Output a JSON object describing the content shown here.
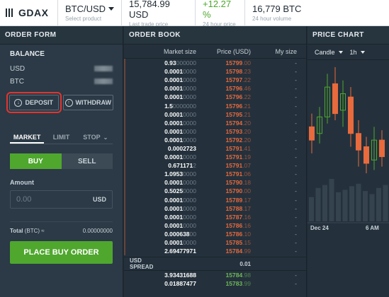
{
  "header": {
    "logo": "GDAX",
    "product": {
      "value": "BTC/USD",
      "caption": "Select product"
    },
    "last_trade": {
      "value": "15,784.99 USD",
      "caption": "Last trade price"
    },
    "change": {
      "value": "+12.27 %",
      "caption": "24 hour price"
    },
    "volume": {
      "value": "16,779 BTC",
      "caption": "24 hour volume"
    },
    "colors": {
      "green": "#4fa72e",
      "red": "#e86a3d",
      "annotation": "#e3342f"
    }
  },
  "order_form": {
    "title": "ORDER FORM",
    "balance_title": "BALANCE",
    "balances": [
      {
        "currency": "USD"
      },
      {
        "currency": "BTC"
      }
    ],
    "deposit_label": "DEPOSIT",
    "withdraw_label": "WITHDRAW",
    "tabs": [
      "MARKET",
      "LIMIT",
      "STOP"
    ],
    "buy_label": "BUY",
    "sell_label": "SELL",
    "amount_label": "Amount",
    "amount_placeholder": "0.00",
    "amount_unit": "USD",
    "total_label": "Total",
    "total_unit": "(BTC) ≈",
    "total_value": "0.00000000",
    "place_order_label": "PLACE BUY ORDER"
  },
  "order_book": {
    "title": "ORDER BOOK",
    "columns": [
      "Market size",
      "Price (USD)",
      "My size"
    ],
    "asks": [
      {
        "size_bold": "0.93",
        "size_dim": "000000",
        "price_bold": "15799",
        "price_dim": ".00",
        "mine": "-"
      },
      {
        "size_bold": "0.0001",
        "size_dim": "0000",
        "price_bold": "15798",
        "price_dim": ".23",
        "mine": "-"
      },
      {
        "size_bold": "0.0001",
        "size_dim": "0000",
        "price_bold": "15797",
        "price_dim": ".22",
        "mine": "-"
      },
      {
        "size_bold": "0.0001",
        "size_dim": "0000",
        "price_bold": "15796",
        "price_dim": ".46",
        "mine": "-"
      },
      {
        "size_bold": "0.0001",
        "size_dim": "0000",
        "price_bold": "15796",
        "price_dim": ".22",
        "mine": "-"
      },
      {
        "size_bold": "1.5",
        "size_dim": "0000000",
        "price_bold": "15796",
        "price_dim": ".21",
        "mine": "-"
      },
      {
        "size_bold": "0.0001",
        "size_dim": "0000",
        "price_bold": "15795",
        "price_dim": ".21",
        "mine": "-"
      },
      {
        "size_bold": "0.0001",
        "size_dim": "0000",
        "price_bold": "15794",
        "price_dim": ".20",
        "mine": "-"
      },
      {
        "size_bold": "0.0001",
        "size_dim": "0000",
        "price_bold": "15793",
        "price_dim": ".20",
        "mine": "-"
      },
      {
        "size_bold": "0.0001",
        "size_dim": "0000",
        "price_bold": "15792",
        "price_dim": ".20",
        "mine": "-"
      },
      {
        "size_bold": "0.0002723",
        "size_dim": "",
        "price_bold": "15791",
        "price_dim": ".41",
        "mine": "-"
      },
      {
        "size_bold": "0.0001",
        "size_dim": "0000",
        "price_bold": "15791",
        "price_dim": ".19",
        "mine": "-"
      },
      {
        "size_bold": "0.671171",
        "size_dim": "2",
        "price_bold": "15791",
        "price_dim": ".07",
        "mine": "-"
      },
      {
        "size_bold": "1.0953",
        "size_dim": "0000",
        "price_bold": "15791",
        "price_dim": ".06",
        "mine": "-"
      },
      {
        "size_bold": "0.0001",
        "size_dim": "0000",
        "price_bold": "15790",
        "price_dim": ".18",
        "mine": "-"
      },
      {
        "size_bold": "0.5025",
        "size_dim": "0000",
        "price_bold": "15790",
        "price_dim": ".00",
        "mine": "-"
      },
      {
        "size_bold": "0.0001",
        "size_dim": "0000",
        "price_bold": "15789",
        "price_dim": ".17",
        "mine": "-"
      },
      {
        "size_bold": "0.0001",
        "size_dim": "0000",
        "price_bold": "15788",
        "price_dim": ".17",
        "mine": "-"
      },
      {
        "size_bold": "0.0001",
        "size_dim": "0000",
        "price_bold": "15787",
        "price_dim": ".16",
        "mine": "-"
      },
      {
        "size_bold": "0.0001",
        "size_dim": "0000",
        "price_bold": "15786",
        "price_dim": ".16",
        "mine": "-"
      },
      {
        "size_bold": "0.000638",
        "size_dim": "00",
        "price_bold": "15786",
        "price_dim": ".10",
        "mine": "-"
      },
      {
        "size_bold": "0.0001",
        "size_dim": "0000",
        "price_bold": "15785",
        "price_dim": ".15",
        "mine": "-"
      },
      {
        "size_bold": "2.69477971",
        "size_dim": "",
        "price_bold": "15784",
        "price_dim": ".99",
        "mine": "-"
      }
    ],
    "spread_label": "USD SPREAD",
    "spread_value": "0.01",
    "bids": [
      {
        "size_bold": "3.93431688",
        "size_dim": "",
        "price_bold": "15784",
        "price_dim": ".98",
        "mine": "-"
      },
      {
        "size_bold": "0.01887477",
        "size_dim": "",
        "price_bold": "15783",
        "price_dim": ".99",
        "mine": "-"
      }
    ]
  },
  "price_chart": {
    "title": "PRICE CHART",
    "chart_type_label": "Candle",
    "interval_label": "1h",
    "x_labels": [
      "Dec 24",
      "6 AM"
    ],
    "candles": [
      {
        "open": 15560,
        "close": 15520,
        "high": 15600,
        "low": 15480,
        "dir": "down"
      },
      {
        "open": 15540,
        "close": 15590,
        "high": 15620,
        "low": 15510,
        "dir": "up"
      },
      {
        "open": 15590,
        "close": 15680,
        "high": 15720,
        "low": 15570,
        "dir": "up"
      },
      {
        "open": 15690,
        "close": 15600,
        "high": 15740,
        "low": 15580,
        "dir": "down"
      },
      {
        "open": 15610,
        "close": 15660,
        "high": 15700,
        "low": 15560,
        "dir": "up"
      },
      {
        "open": 15650,
        "close": 15540,
        "high": 15680,
        "low": 15500,
        "dir": "down"
      },
      {
        "open": 15540,
        "close": 15490,
        "high": 15580,
        "low": 15440,
        "dir": "down"
      },
      {
        "open": 15500,
        "close": 15450,
        "high": 15530,
        "low": 15420,
        "dir": "down"
      },
      {
        "open": 15460,
        "close": 15520,
        "high": 15560,
        "low": 15430,
        "dir": "up"
      },
      {
        "open": 15520,
        "close": 15470,
        "high": 15550,
        "low": 15440,
        "dir": "down"
      }
    ],
    "volumes": [
      40,
      55,
      60,
      70,
      48,
      52,
      58,
      62,
      50,
      45,
      55,
      60
    ]
  }
}
